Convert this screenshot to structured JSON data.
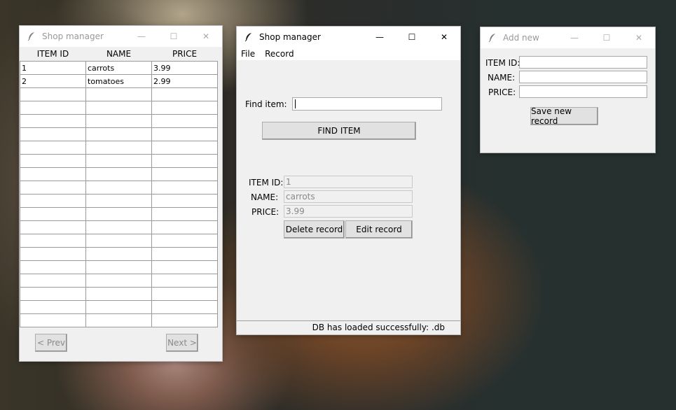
{
  "colors": {
    "window_bg": "#f0f0f0",
    "titlebar_bg": "#ffffff",
    "button_bg": "#e1e1e1"
  },
  "icons": {
    "app": "feather-icon",
    "minimize": "minimize-icon",
    "maximize": "maximize-icon",
    "close": "close-icon"
  },
  "table_window": {
    "title": "Shop manager",
    "columns": [
      "ITEM ID",
      "NAME",
      "PRICE"
    ],
    "rows": [
      [
        "1",
        "carrots",
        "3.99"
      ],
      [
        "2",
        "tomatoes",
        "2.99"
      ],
      [
        "",
        "",
        ""
      ],
      [
        "",
        "",
        ""
      ],
      [
        "",
        "",
        ""
      ],
      [
        "",
        "",
        ""
      ],
      [
        "",
        "",
        ""
      ],
      [
        "",
        "",
        ""
      ],
      [
        "",
        "",
        ""
      ],
      [
        "",
        "",
        ""
      ],
      [
        "",
        "",
        ""
      ],
      [
        "",
        "",
        ""
      ],
      [
        "",
        "",
        ""
      ],
      [
        "",
        "",
        ""
      ],
      [
        "",
        "",
        ""
      ],
      [
        "",
        "",
        ""
      ],
      [
        "",
        "",
        ""
      ],
      [
        "",
        "",
        ""
      ],
      [
        "",
        "",
        ""
      ],
      [
        "",
        "",
        ""
      ]
    ],
    "prev_label": "< Prev",
    "next_label": "Next >"
  },
  "main_window": {
    "title": "Shop manager",
    "menu": [
      "File",
      "Record"
    ],
    "find_label": "Find item:",
    "find_value": "",
    "find_button": "FIND ITEM",
    "item_id_label": "ITEM ID:",
    "name_label": "NAME:",
    "price_label": "PRICE:",
    "item_id_value": "1",
    "name_value": "carrots",
    "price_value": "3.99",
    "delete_button": "Delete record",
    "edit_button": "Edit record",
    "status": "DB has loaded successfully: .db"
  },
  "add_window": {
    "title": "Add new",
    "item_id_label": "ITEM ID:",
    "name_label": "NAME:",
    "price_label": "PRICE:",
    "item_id_value": "",
    "name_value": "",
    "price_value": "",
    "save_button": "Save new record"
  }
}
